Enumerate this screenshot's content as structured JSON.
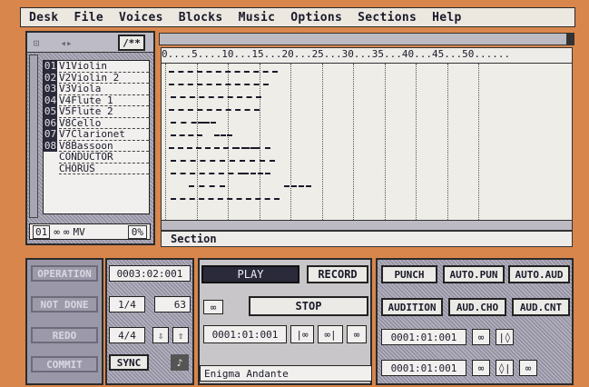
{
  "menu": [
    "Desk",
    "File",
    "Voices",
    "Blocks",
    "Music",
    "Options",
    "Sections",
    "Help"
  ],
  "track_panel": {
    "header_icon_label": "/**",
    "tracks": [
      {
        "num": "01",
        "name": "V1Violin"
      },
      {
        "num": "02",
        "name": "V2Violin 2"
      },
      {
        "num": "03",
        "name": "V3Viola"
      },
      {
        "num": "04",
        "name": "V4Flute 1"
      },
      {
        "num": "05",
        "name": "V5Flute 2"
      },
      {
        "num": "06",
        "name": "V8Cello"
      },
      {
        "num": "07",
        "name": "V7Clarionet"
      },
      {
        "num": "08",
        "name": "V8Bassoon"
      },
      {
        "num": "",
        "name": "CONDUCTOR"
      },
      {
        "num": "",
        "name": "CHORUS"
      }
    ],
    "footer_track": "01",
    "footer_mv": "MV",
    "footer_percent": "0%"
  },
  "ruler": "0....5....10...15...20...25...30...35...40...45...50......",
  "section_label": "Section",
  "edit_panel": {
    "operation": "OPERATION",
    "not_done": "NOT DONE",
    "redo": "REDO",
    "commit": "COMMIT"
  },
  "time_panel": {
    "position": "0003:02:001",
    "quantize": "1/4",
    "tempo": "63",
    "meter": "4/4",
    "sync": "SYNC"
  },
  "transport": {
    "play": "PLAY",
    "record": "RECORD",
    "stop": "STOP",
    "locator": "0001:01:001",
    "song_title": "Enigma Andante"
  },
  "punch_panel": {
    "punch": "PUNCH",
    "auto_pun": "AUTO.PUN",
    "auto_aud": "AUTO.AUD",
    "audition": "AUDITION",
    "aud_cho": "AUD.CHO",
    "aud_cnt": "AUD.CNT",
    "in_point": "0001:01:001",
    "out_point": "0001:01:001"
  },
  "colors": {
    "background": "#d8864c",
    "panel": "#c8c6c8",
    "play_active": "#2a2a3a"
  }
}
